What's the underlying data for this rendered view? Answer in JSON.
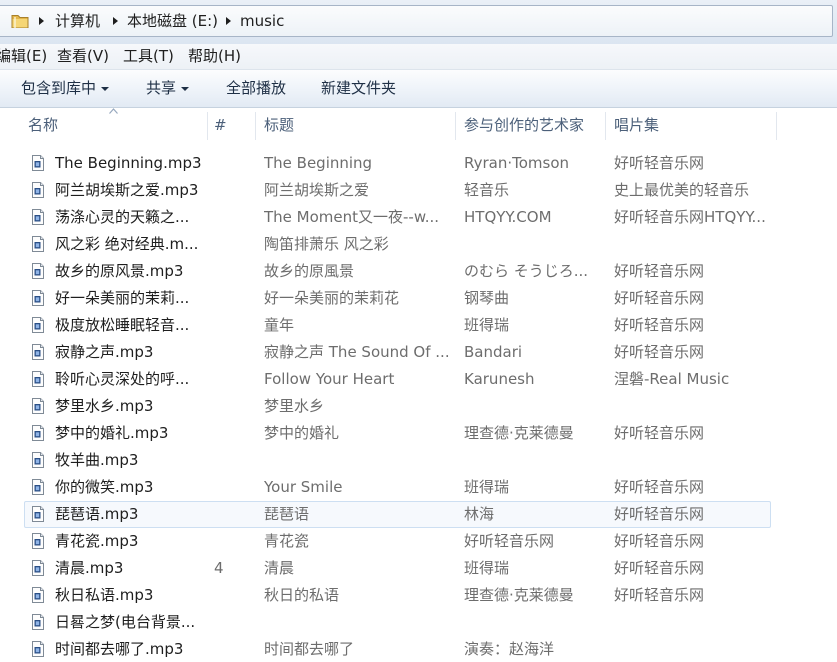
{
  "address": {
    "crumbs": [
      "计算机",
      "本地磁盘 (E:)",
      "music"
    ]
  },
  "menu": {
    "items": [
      "编辑(E)",
      "查看(V)",
      "工具(T)",
      "帮助(H)"
    ]
  },
  "toolbar": {
    "items": [
      {
        "label": "包含到库中",
        "has_dropdown": true
      },
      {
        "label": "共享",
        "has_dropdown": true
      },
      {
        "label": "全部播放",
        "has_dropdown": false
      },
      {
        "label": "新建文件夹",
        "has_dropdown": false
      }
    ]
  },
  "columns": {
    "name": {
      "label": "名称",
      "sorted_ascending": true
    },
    "number": {
      "label": "#"
    },
    "title": {
      "label": "标题"
    },
    "artist": {
      "label": "参与创作的艺术家"
    },
    "album": {
      "label": "唱片集"
    }
  },
  "files": [
    {
      "name": "The Beginning.mp3",
      "title": "The Beginning",
      "artist": "Ryran·Tomson",
      "album": "好听轻音乐网"
    },
    {
      "name": "阿兰胡埃斯之爱.mp3",
      "title": "阿兰胡埃斯之爱",
      "artist": "轻音乐",
      "album": "史上最优美的轻音乐"
    },
    {
      "name": "荡涤心灵的天籁之...",
      "title": "The Moment又一夜--w...",
      "artist": "HTQYY.COM",
      "album": "好听轻音乐网HTQYY..."
    },
    {
      "name": "风之彩 绝对经典.m...",
      "title": "陶笛排萧乐 风之彩"
    },
    {
      "name": "故乡的原风景.mp3",
      "title": "故乡的原風景",
      "artist": "のむら そうじろ...",
      "album": "好听轻音乐网"
    },
    {
      "name": "好一朵美丽的茉莉...",
      "title": "好一朵美丽的茉莉花",
      "artist": "钢琴曲",
      "album": "好听轻音乐网"
    },
    {
      "name": "极度放松睡眠轻音...",
      "title": "童年",
      "artist": "班得瑞",
      "album": "好听轻音乐网"
    },
    {
      "name": "寂静之声.mp3",
      "title": "寂静之声 The Sound Of ...",
      "artist": "Bandari",
      "album": "好听轻音乐网"
    },
    {
      "name": "聆听心灵深处的呼...",
      "title": "Follow Your Heart",
      "artist": "Karunesh",
      "album": "涅磐-Real Music"
    },
    {
      "name": "梦里水乡.mp3",
      "title": "梦里水乡"
    },
    {
      "name": "梦中的婚礼.mp3",
      "title": "梦中的婚礼",
      "artist": "理查德·克莱德曼",
      "album": "好听轻音乐网"
    },
    {
      "name": "牧羊曲.mp3"
    },
    {
      "name": "你的微笑.mp3",
      "title": "Your Smile",
      "artist": "班得瑞",
      "album": "好听轻音乐网"
    },
    {
      "name": "琵琶语.mp3",
      "title": "琵琶语",
      "artist": "林海",
      "album": "好听轻音乐网",
      "highlighted": true
    },
    {
      "name": "青花瓷.mp3",
      "title": "青花瓷",
      "artist": "好听轻音乐网",
      "album": "好听轻音乐网"
    },
    {
      "name": "清晨.mp3",
      "number": "4",
      "title": "清晨",
      "artist": "班得瑞",
      "album": "好听轻音乐网"
    },
    {
      "name": "秋日私语.mp3",
      "title": "秋日的私语",
      "artist": "理查德·克莱德曼",
      "album": "好听轻音乐网"
    },
    {
      "name": "日晷之梦(电台背景..."
    },
    {
      "name": "时间都去哪了.mp3",
      "title": "时间都去哪了",
      "artist": "演奏：赵海洋"
    }
  ],
  "icons": {
    "location": "folder-icon",
    "breadcrumb_separator": "chevron-right-icon",
    "dropdown": "chevron-down-icon",
    "sort": "sort-ascending-icon",
    "file": "audio-file-icon"
  },
  "colors": {
    "name_text": "#1e1e1e",
    "detail_text": "#6d6d6d",
    "header_text": "#4c607a",
    "highlight_border": "#cddff2",
    "highlight_fill": "#f6f9fd"
  }
}
